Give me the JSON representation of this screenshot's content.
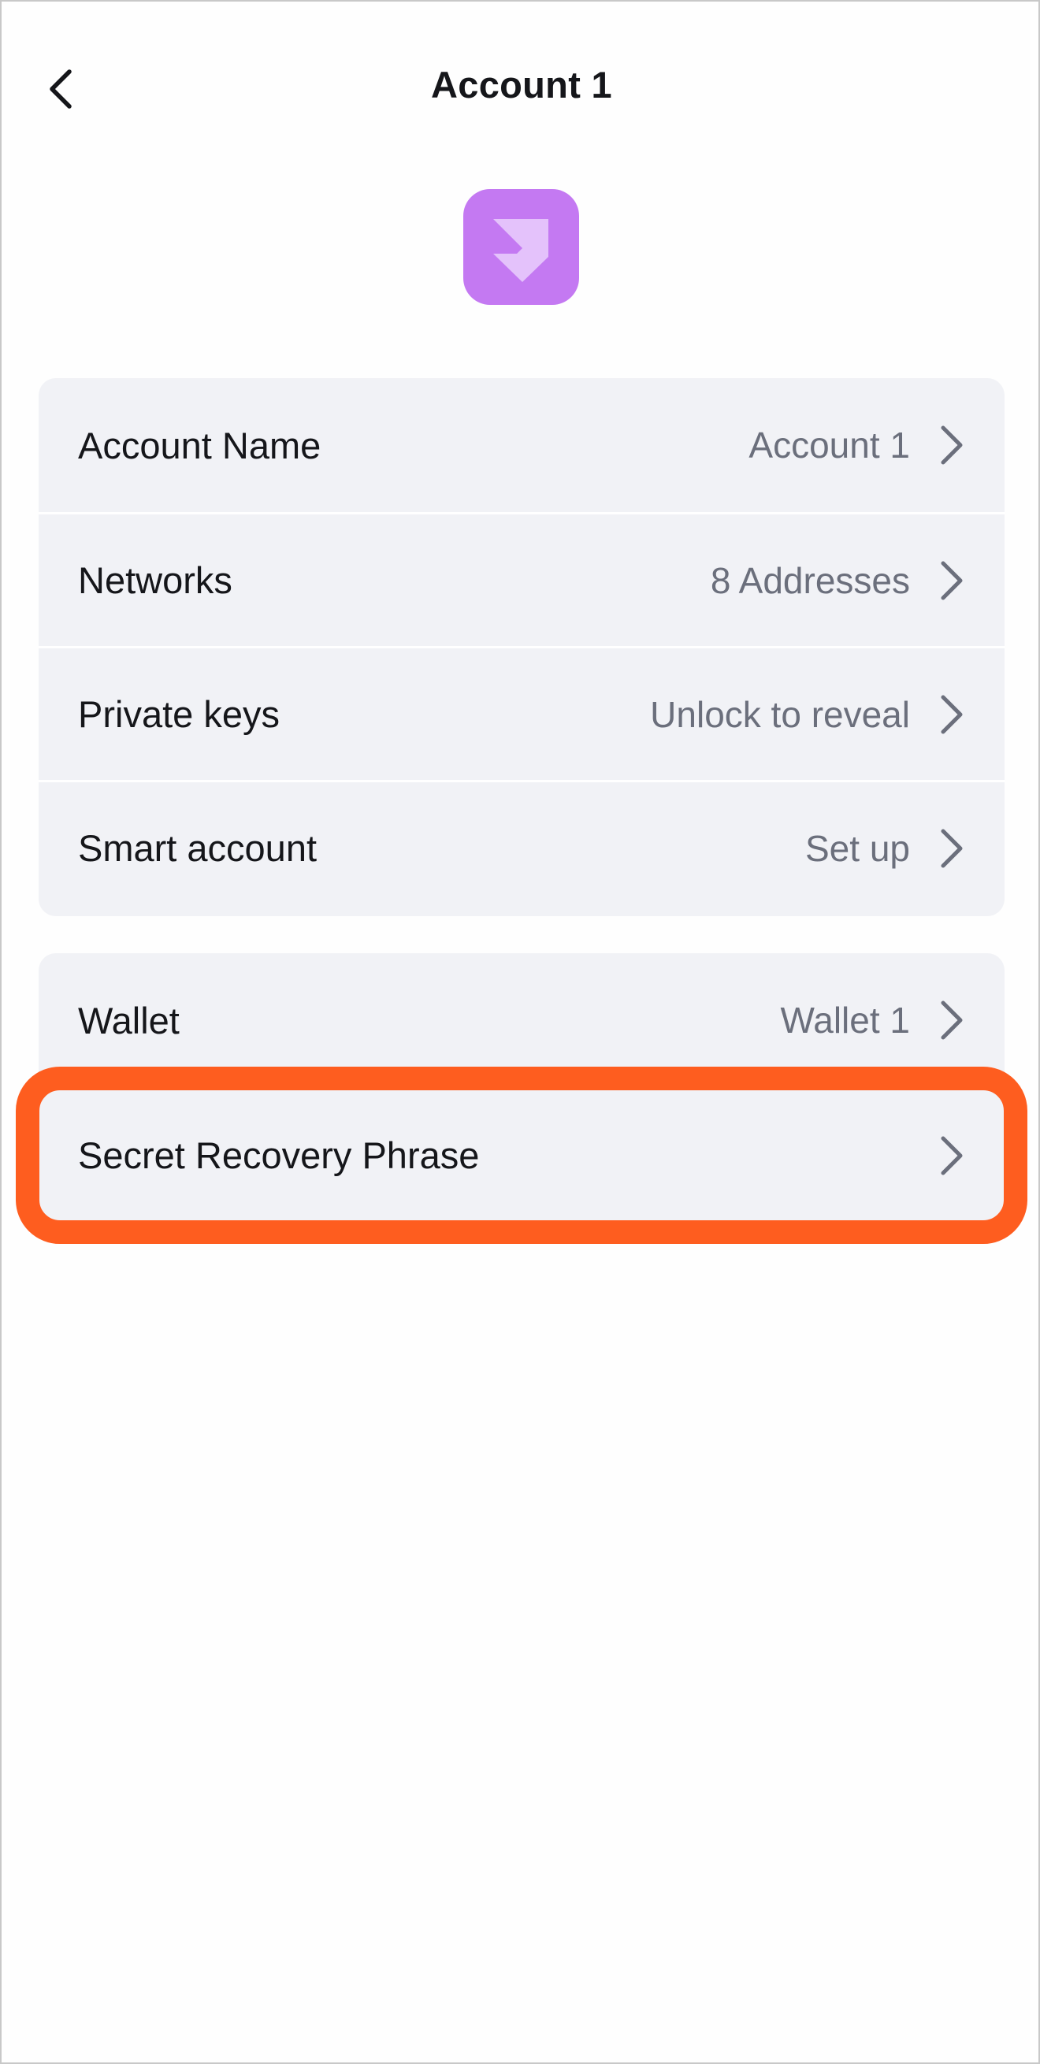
{
  "header": {
    "title": "Account 1"
  },
  "icons": {
    "back": "chevron-left-icon",
    "avatar": "account-avatar-icon",
    "row_arrow": "chevron-right-icon"
  },
  "account_details": {
    "rows": [
      {
        "label": "Account Name",
        "value": "Account 1"
      },
      {
        "label": "Networks",
        "value": "8 Addresses"
      },
      {
        "label": "Private keys",
        "value": "Unlock to reveal"
      },
      {
        "label": "Smart account",
        "value": "Set up"
      }
    ]
  },
  "wallet_section": {
    "rows": [
      {
        "label": "Wallet",
        "value": "Wallet 1"
      },
      {
        "label": "Secret Recovery Phrase",
        "value": ""
      }
    ]
  },
  "colors": {
    "avatar_bg": "#c479f2",
    "avatar_glyph": "#e6c6fb",
    "highlight": "#fe5d1f",
    "row_bg": "#f1f2f6",
    "secondary_text": "#6b6f7c"
  }
}
